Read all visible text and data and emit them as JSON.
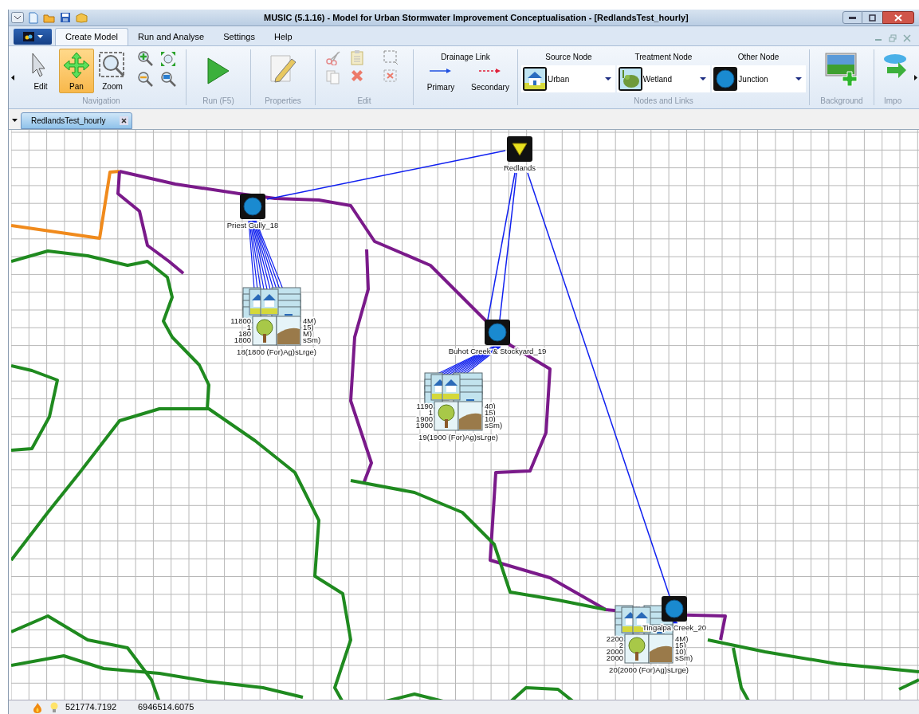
{
  "window": {
    "title": "MUSIC (5.1.16) - Model for Urban Stormwater Improvement Conceptualisation - [RedlandsTest_hourly]"
  },
  "ribbon_tabs": [
    {
      "label": "Create Model",
      "selected": true
    },
    {
      "label": "Run and Analyse",
      "selected": false
    },
    {
      "label": "Settings",
      "selected": false
    },
    {
      "label": "Help",
      "selected": false
    }
  ],
  "ribbon_groups": [
    {
      "kind": "navigation",
      "label": "Navigation",
      "buttons": [
        {
          "label": "Edit",
          "selected": false
        },
        {
          "label": "Pan",
          "selected": true
        },
        {
          "label": "Zoom",
          "selected": false
        }
      ]
    },
    {
      "kind": "run",
      "label": "Run (F5)"
    },
    {
      "kind": "properties",
      "label": "Properties"
    },
    {
      "kind": "edit",
      "label": "Edit"
    },
    {
      "kind": "drainage",
      "title": "Drainage Link",
      "options": [
        "Primary",
        "Secondary"
      ]
    },
    {
      "kind": "nodes",
      "label": "Nodes and Links",
      "pickers": [
        {
          "title": "Source Node",
          "value": "Urban"
        },
        {
          "title": "Treatment Node",
          "value": "Wetland"
        },
        {
          "title": "Other Node",
          "value": "Junction"
        }
      ]
    },
    {
      "kind": "background",
      "label": "Background"
    },
    {
      "kind": "import",
      "label": "Impo"
    }
  ],
  "document_tabs": [
    {
      "label": "RedlandsTest_hourly",
      "selected": true
    }
  ],
  "diagram": {
    "nodes": [
      {
        "kind": "receiving",
        "label": "Redlands"
      },
      {
        "kind": "junction",
        "label": "Priest Gully_18"
      },
      {
        "kind": "junction",
        "label": "Buhot Creek & Stockyard_19"
      },
      {
        "kind": "junction",
        "label": "Tingalpa Creek_20"
      }
    ],
    "clusters": [
      {
        "rows": [
          [
            "11800",
            "4M)"
          ],
          [
            "1",
            "15)"
          ],
          [
            "180",
            "M)"
          ],
          [
            "1800",
            "sSm)"
          ]
        ],
        "bottom": "18(1800 (For)Ag)sLrge)"
      },
      {
        "rows": [
          [
            "1190",
            "40)"
          ],
          [
            "1",
            "15)"
          ],
          [
            "1900",
            "10)"
          ],
          [
            "1900",
            "sSm)"
          ]
        ],
        "bottom": "19(1900 (For)Ag)sLrge)"
      },
      {
        "rows": [
          [
            "2200",
            "4M)"
          ],
          [
            "2",
            "15)"
          ],
          [
            "2000",
            "10)"
          ],
          [
            "2000",
            "sSm)"
          ]
        ],
        "bottom": "20(2000 (For)Ag)sLrge)"
      }
    ]
  },
  "status_bar": {
    "easting": "521774.7192",
    "northing": "6946514.6075"
  }
}
